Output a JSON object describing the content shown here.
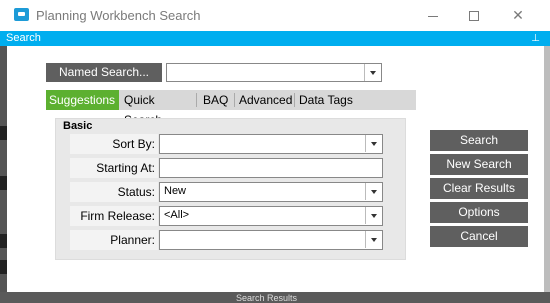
{
  "window": {
    "title": "Planning Workbench Search"
  },
  "header": {
    "section_label": "Search",
    "pin_icon": "pin-icon"
  },
  "named_search": {
    "button_label": "Named Search...",
    "value": ""
  },
  "tabs": [
    {
      "label": "Suggestions",
      "active": true
    },
    {
      "label": "Quick Search",
      "active": false
    },
    {
      "label": "BAQ",
      "active": false
    },
    {
      "label": "Advanced",
      "active": false
    },
    {
      "label": "Data Tags",
      "active": false
    }
  ],
  "basic": {
    "group_label": "Basic",
    "fields": [
      {
        "label": "Sort By:",
        "value": "",
        "type": "combo"
      },
      {
        "label": "Starting At:",
        "value": "",
        "type": "text"
      },
      {
        "label": "Status:",
        "value": "New",
        "type": "combo"
      },
      {
        "label": "Firm Release:",
        "value": "<All>",
        "type": "combo"
      },
      {
        "label": "Planner:",
        "value": "",
        "type": "combo"
      }
    ]
  },
  "actions": [
    {
      "label": "Search"
    },
    {
      "label": "New Search"
    },
    {
      "label": "Clear Results"
    },
    {
      "label": "Options"
    },
    {
      "label": "Cancel"
    }
  ],
  "background": {
    "bottom_text": "Search Results"
  },
  "colors": {
    "accent_blue": "#00aeef",
    "active_tab_green": "#5cb030",
    "button_gray": "#5f5f5f"
  }
}
